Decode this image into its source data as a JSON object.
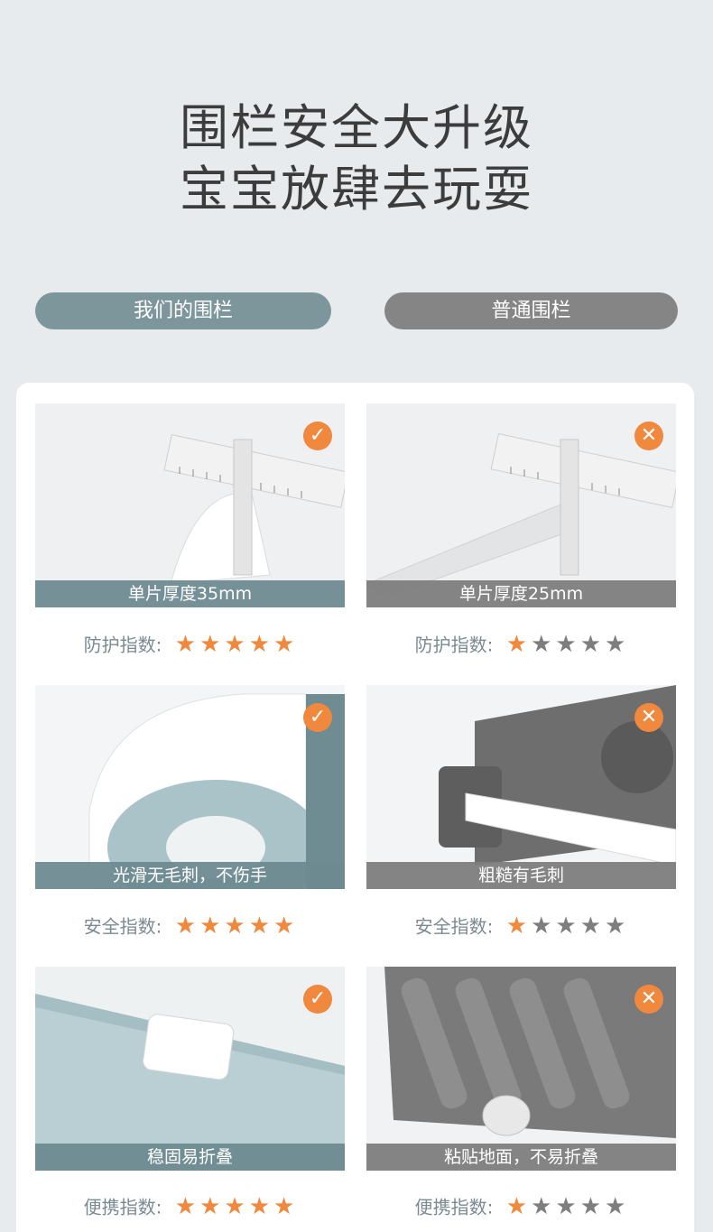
{
  "headline": {
    "line1": "围栏安全大升级",
    "line2": "宝宝放肆去玩耍"
  },
  "columns": {
    "ours": "我们的围栏",
    "normal": "普通围栏"
  },
  "badges": {
    "check": "✓",
    "cross": "✕"
  },
  "rows": [
    {
      "ours": {
        "caption": "单片厚度35mm",
        "rating_label": "防护指数:",
        "stars": 5
      },
      "normal": {
        "caption": "单片厚度25mm",
        "rating_label": "防护指数:",
        "stars": 1
      }
    },
    {
      "ours": {
        "caption": "光滑无毛刺，不伤手",
        "rating_label": "安全指数:",
        "stars": 5
      },
      "normal": {
        "caption": "粗糙有毛刺",
        "rating_label": "安全指数:",
        "stars": 1
      }
    },
    {
      "ours": {
        "caption": "稳固易折叠",
        "rating_label": "便携指数:",
        "stars": 5
      },
      "normal": {
        "caption": "粘贴地面，不易折叠",
        "rating_label": "便携指数:",
        "stars": 1
      }
    }
  ],
  "star_total": 5,
  "colors": {
    "accent": "#f0883e",
    "ours_pill": "#7d969c",
    "normal_pill": "#858585"
  }
}
